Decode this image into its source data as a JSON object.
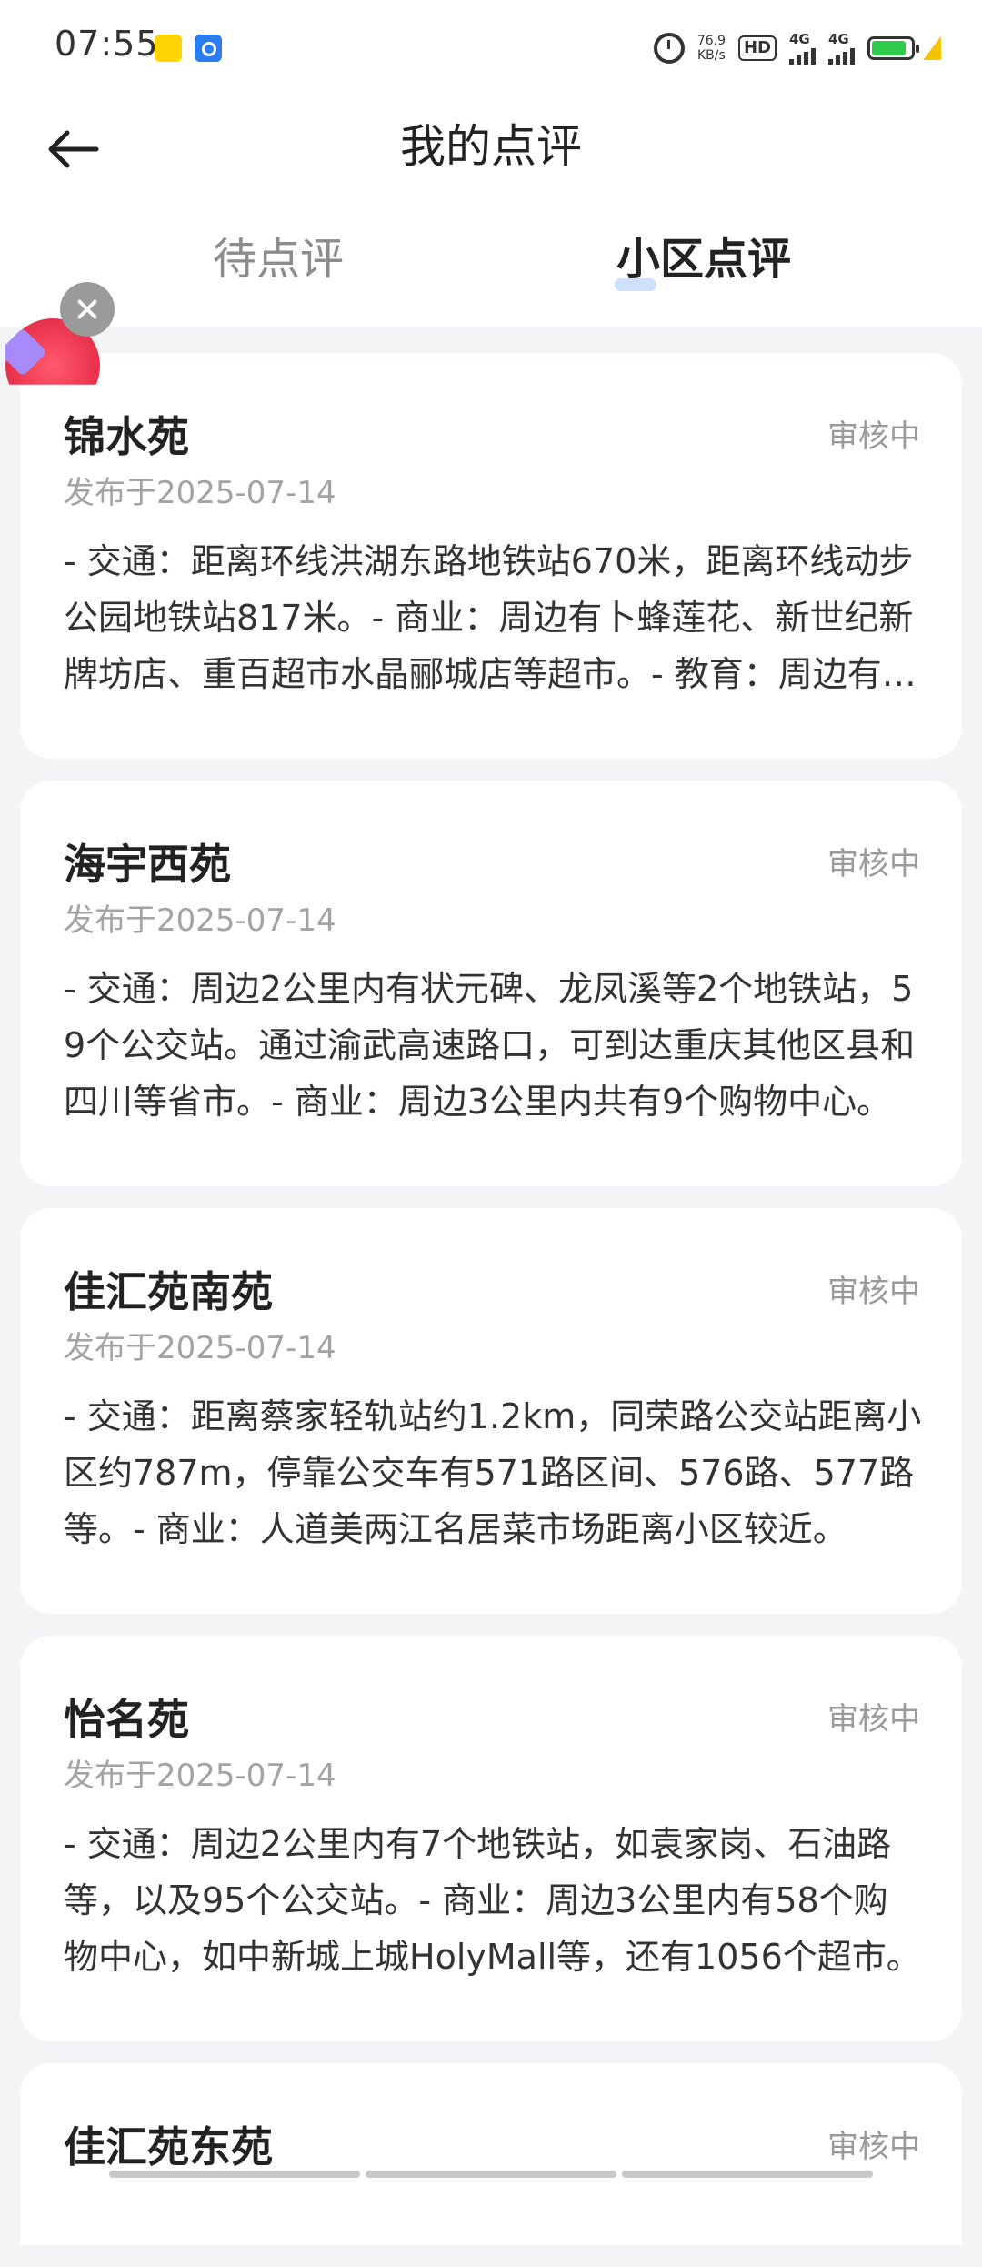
{
  "status_bar": {
    "time": "07:55",
    "net_speed_value": "76.9",
    "net_speed_unit": "KB/s",
    "hd_label": "HD",
    "network_1": "4G",
    "network_2": "4G",
    "battery_level": 0.9,
    "battery_color": "#2ecc4a"
  },
  "header": {
    "title": "我的点评"
  },
  "tabs": {
    "pending_label": "待点评",
    "community_label": "小区点评",
    "active_tab": "community"
  },
  "colors": {
    "accent_indicator": "#cfe0ff",
    "status_text": "#9a9a9a"
  },
  "reviews": [
    {
      "name": "锦水苑",
      "status": "审核中",
      "date": "发布于2025-07-14",
      "content": "- 交通：距离环线洪湖东路地铁站670米，距离环线动步公园地铁站817米。- 商业：周边有卜蜂莲花、新世纪新牌坊店、重百超市水晶郦城店等超市。- 教育：周边有多所学校。"
    },
    {
      "name": "海宇西苑",
      "status": "审核中",
      "date": "发布于2025-07-14",
      "content": "- 交通：周边2公里内有状元碑、龙凤溪等2个地铁站，59个公交站。通过渝武高速路口，可到达重庆其他区县和四川等省市。- 商业：周边3公里内共有9个购物中心。"
    },
    {
      "name": "佳汇苑南苑",
      "status": "审核中",
      "date": "发布于2025-07-14",
      "content": "- 交通：距离蔡家轻轨站约1.2km，同荣路公交站距离小区约787m，停靠公交车有571路区间、576路、577路等。- 商业：人道美两江名居菜市场距离小区较近。"
    },
    {
      "name": "怡名苑",
      "status": "审核中",
      "date": "发布于2025-07-14",
      "content": "- 交通：周边2公里内有7个地铁站，如袁家岗、石油路等，以及95个公交站。- 商业：周边3公里内有58个购物中心，如中新城上城HolyMall等，还有1056个超市。"
    },
    {
      "name": "佳汇苑东苑",
      "status": "审核中",
      "date": "",
      "content": ""
    }
  ]
}
